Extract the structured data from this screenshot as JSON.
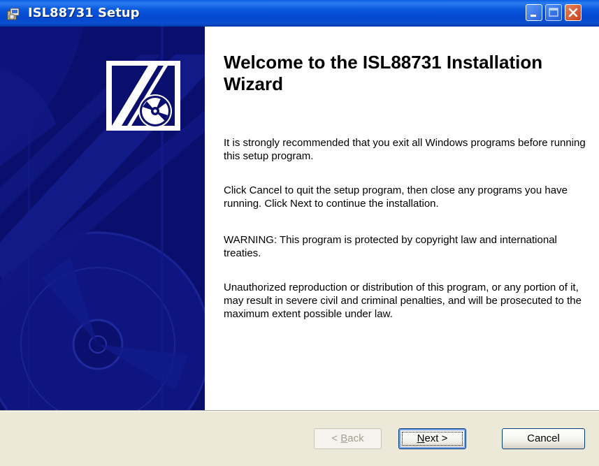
{
  "window": {
    "title": "ISL88731 Setup",
    "icon": "setup-installer-icon"
  },
  "title_bar_buttons": {
    "minimize_icon": "minimize-icon",
    "maximize_icon": "maximize-icon",
    "close_icon": "close-icon"
  },
  "banner": {
    "logo_icon": "installer-cd-logo-icon",
    "background_color": "#0a0f6e"
  },
  "content": {
    "heading": "Welcome to the ISL88731 Installation Wizard",
    "paragraphs": [
      "It is strongly recommended that you exit all Windows programs before running this setup program.",
      "Click Cancel to quit the setup program, then close any programs you have running.  Click Next to continue the installation.",
      "WARNING: This program is protected by copyright law and international treaties.",
      "Unauthorized reproduction or distribution of this program, or any portion of it, may result in severe civil and criminal penalties, and will be prosecuted to the maximum extent possible under law."
    ]
  },
  "buttons": {
    "back_label": "< Back",
    "back_mnemonic": "B",
    "back_enabled": false,
    "next_label": "Next >",
    "next_mnemonic": "N",
    "cancel_label": "Cancel"
  },
  "colors": {
    "title_bar": "#0a58dc",
    "banner": "#0a0f6e",
    "dialog_face": "#ece9d8"
  }
}
